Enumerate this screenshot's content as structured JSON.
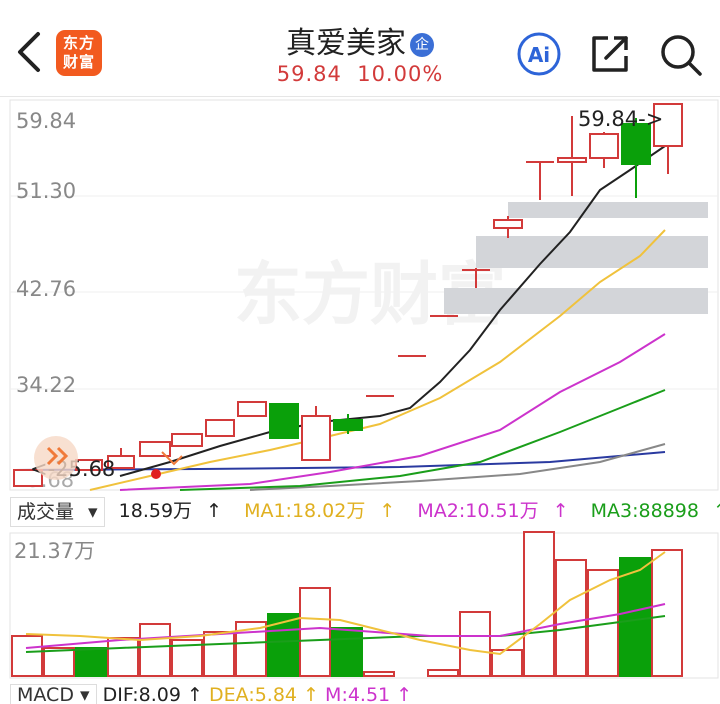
{
  "header": {
    "logo_text_line1": "东方",
    "logo_text_line2": "财富",
    "stock_name": "真爱美家",
    "badge": "企",
    "price": "59.84",
    "change_pct": "10.00%",
    "ai_label": "Ai",
    "icons": [
      "back-arrow-icon",
      "ai-icon",
      "share-icon",
      "search-icon"
    ]
  },
  "kline": {
    "y_labels": [
      "59.84",
      "51.30",
      "42.76",
      "34.22",
      "25.68"
    ],
    "high_marker": "59.84->",
    "low_marker": "<-25.68",
    "watermark": "东方财富"
  },
  "volume_bar": {
    "selector": "成交量",
    "value": "18.59万",
    "ma1": "MA1:18.02万",
    "ma2": "MA2:10.51万",
    "ma3": "MA3:88898",
    "arrow": "↑"
  },
  "volume_chart": {
    "y_label": "21.37万"
  },
  "macd_bar": {
    "selector": "MACD",
    "dif": "DIF:8.09",
    "dea": "DEA:5.84",
    "m": "M:4.51",
    "arrow": "↑"
  },
  "colors": {
    "up": "#d23a3a",
    "down": "#0aa00a",
    "ma1": "#f0c23c",
    "ma2": "#cc33cc",
    "ma3": "#1a9e1a",
    "ma4": "#888888",
    "ma5": "#2a3aa0"
  }
}
